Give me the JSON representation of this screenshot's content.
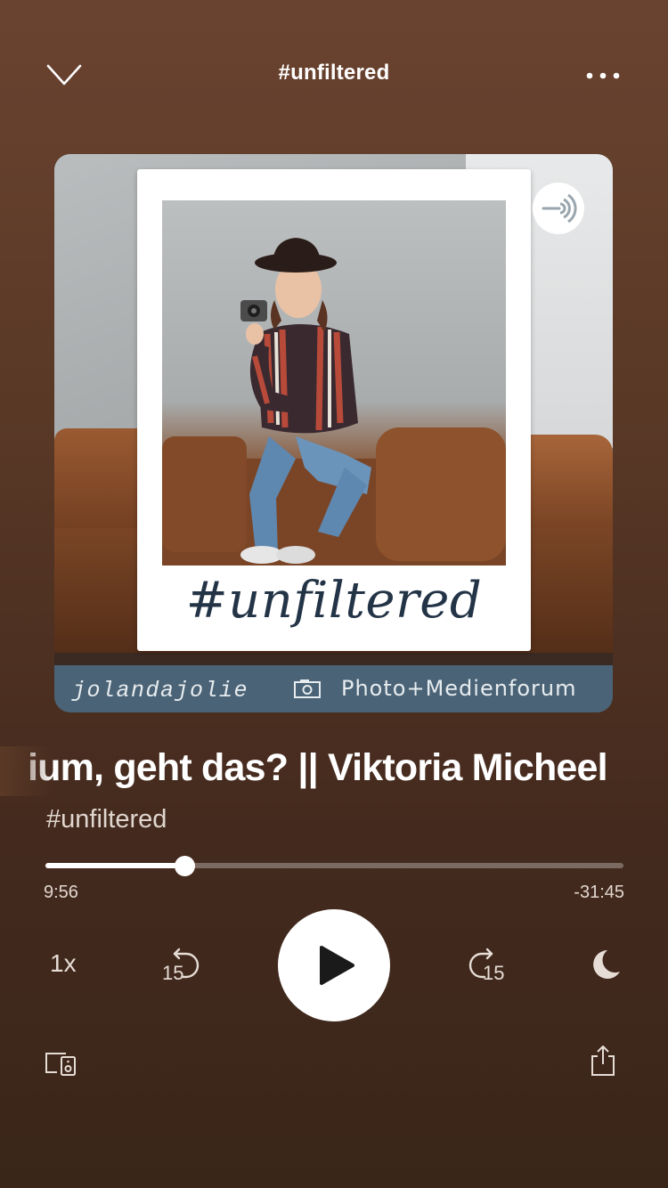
{
  "header": {
    "title": "#unfiltered",
    "collapse_icon": "chevron-down-icon",
    "more_icon": "more-dots-icon"
  },
  "artwork": {
    "caption": "#unfiltered",
    "credit_left": "jolandajolie",
    "credit_right": "Photo+Medienforum",
    "badge_icon": "anchor-podcast-icon"
  },
  "episode": {
    "title_visible": "ium, geht das? || Viktoria Micheel",
    "show": "#unfiltered"
  },
  "progress": {
    "elapsed": "9:56",
    "remaining": "-31:45",
    "fraction": 0.24
  },
  "controls": {
    "speed": "1x",
    "rewind_seconds": "15",
    "forward_seconds": "15",
    "play_icon": "play-icon",
    "sleep_icon": "moon-icon",
    "devices_icon": "devices-icon",
    "share_icon": "share-icon"
  },
  "colors": {
    "bg_top": "#6a4330",
    "bg_bottom": "#3a2519",
    "caption_ink": "#243447",
    "credit_bar": "#4a6376"
  }
}
